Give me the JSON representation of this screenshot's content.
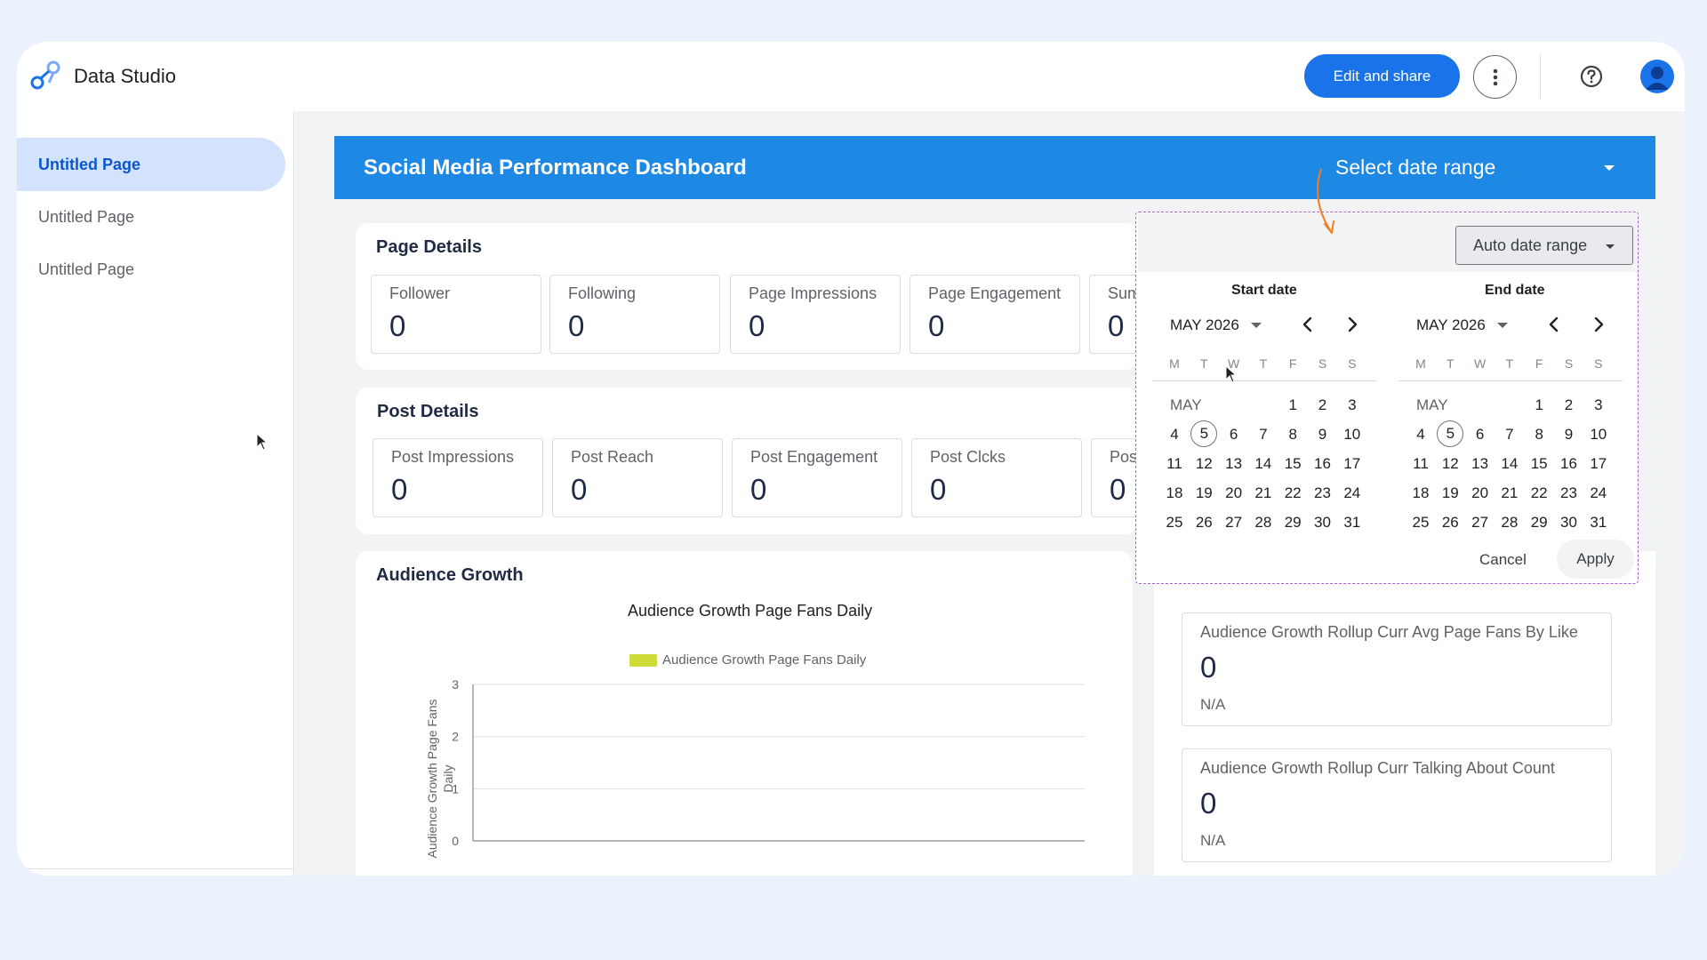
{
  "app": {
    "title": "Data Studio",
    "edit_share_label": "Edit and share"
  },
  "sidebar": {
    "items": [
      {
        "label": "Untitled Page"
      },
      {
        "label": "Untitled Page"
      },
      {
        "label": "Untitled Page"
      }
    ]
  },
  "report": {
    "title": "Social Media Performance Dashboard",
    "date_range_label": "Select date range",
    "page_details": {
      "title": "Page Details",
      "cards": [
        {
          "label": "Follower",
          "value": "0"
        },
        {
          "label": "Following",
          "value": "0"
        },
        {
          "label": "Page Impressions",
          "value": "0"
        },
        {
          "label": "Page Engagement",
          "value": "0"
        },
        {
          "label": "Sum",
          "value": "0"
        }
      ]
    },
    "post_details": {
      "title": "Post Details",
      "cards": [
        {
          "label": "Post Impressions",
          "value": "0"
        },
        {
          "label": "Post Reach",
          "value": "0"
        },
        {
          "label": "Post Engagement",
          "value": "0"
        },
        {
          "label": "Post Clcks",
          "value": "0"
        },
        {
          "label": "Pos",
          "value": "0"
        }
      ]
    },
    "audience_growth": {
      "title": "Audience Growth"
    },
    "right_cards": [
      {
        "label": "Audience Growth Rollup Curr Avg Page Fans By Like",
        "value": "0",
        "sub": "N/A"
      },
      {
        "label": "Audience Growth Rollup Curr Talking About Count",
        "value": "0",
        "sub": "N/A"
      }
    ]
  },
  "chart_data": {
    "type": "bar",
    "title": "Audience Growth Page Fans Daily",
    "series": [
      {
        "name": "Audience Growth Page Fans Daily",
        "values": []
      }
    ],
    "categories": [],
    "xlabel": "",
    "ylabel": "Audience Growth Page Fans Daily",
    "yticks": [
      "3",
      "2",
      "1",
      "0"
    ],
    "ylim": [
      0,
      3
    ],
    "grid": true,
    "legend": "top",
    "color": "#cddc39"
  },
  "date_picker": {
    "auto_label": "Auto date range",
    "start_header": "Start date",
    "end_header": "End date",
    "start_month": "MAY 2026",
    "end_month": "MAY 2026",
    "days_of_week": [
      "M",
      "T",
      "W",
      "T",
      "F",
      "S",
      "S"
    ],
    "month_label": "MAY",
    "today": "5",
    "cancel_label": "Cancel",
    "apply_label": "Apply"
  },
  "colors": {
    "accent": "#1a73e8",
    "header": "#1e88e5",
    "legend_swatch": "#cddc39"
  }
}
